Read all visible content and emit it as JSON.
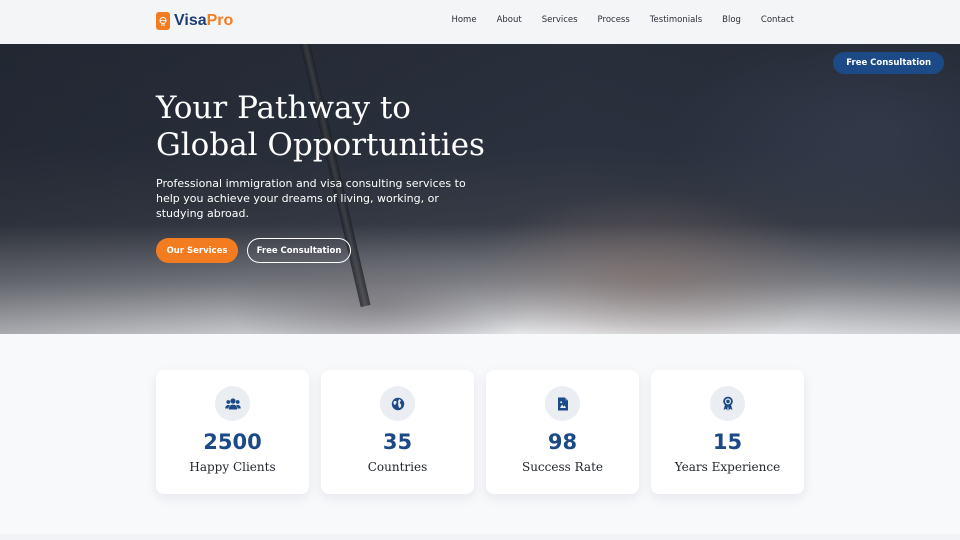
{
  "brand": {
    "name_part1": "Visa",
    "name_part2": "Pro"
  },
  "nav": {
    "items": [
      {
        "label": "Home"
      },
      {
        "label": "About"
      },
      {
        "label": "Services"
      },
      {
        "label": "Process"
      },
      {
        "label": "Testimonials"
      },
      {
        "label": "Blog"
      },
      {
        "label": "Contact"
      }
    ]
  },
  "hero": {
    "top_cta": "Free Consultation",
    "title": "Your Pathway to Global Opportunities",
    "subtitle": "Professional immigration and visa consulting services to help you achieve your dreams of living, working, or studying abroad.",
    "primary_button": "Our Services",
    "secondary_button": "Free Consultation"
  },
  "stats": [
    {
      "icon": "users-icon",
      "value": "2500",
      "label": "Happy Clients"
    },
    {
      "icon": "globe-icon",
      "value": "35",
      "label": "Countries"
    },
    {
      "icon": "document-icon",
      "value": "98",
      "label": "Success Rate"
    },
    {
      "icon": "award-icon",
      "value": "15",
      "label": "Years Experience"
    }
  ],
  "colors": {
    "brand_orange": "#f47c20",
    "brand_navy": "#1c4a86",
    "icon_bg": "#eaedf2"
  }
}
